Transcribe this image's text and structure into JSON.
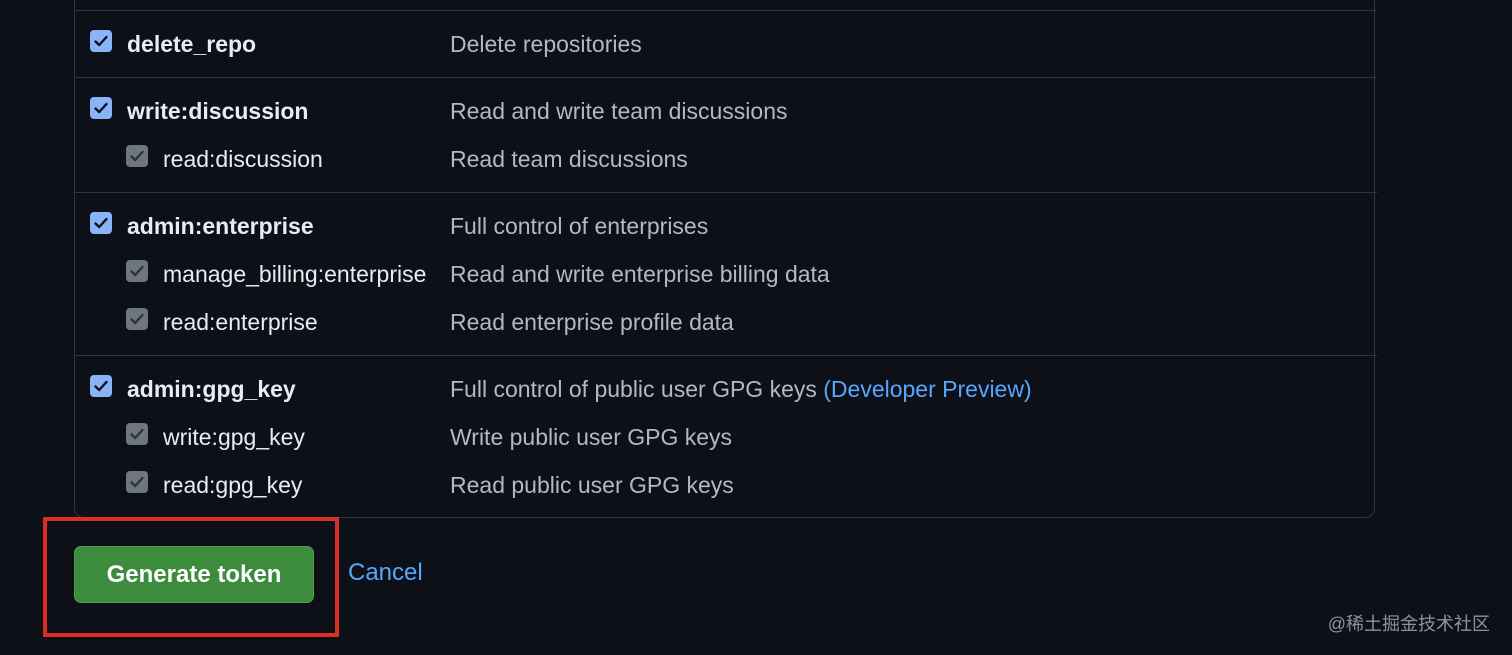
{
  "scope_groups": [
    {
      "scopes": [
        {
          "name": "delete_repo",
          "description": "Delete repositories",
          "checked": true,
          "primary": true
        }
      ]
    },
    {
      "scopes": [
        {
          "name": "write:discussion",
          "description": "Read and write team discussions",
          "checked": true,
          "primary": true
        },
        {
          "name": "read:discussion",
          "description": "Read team discussions",
          "checked": true,
          "primary": false
        }
      ]
    },
    {
      "scopes": [
        {
          "name": "admin:enterprise",
          "description": "Full control of enterprises",
          "checked": true,
          "primary": true
        },
        {
          "name": "manage_billing:enterprise",
          "description": "Read and write enterprise billing data",
          "checked": true,
          "primary": false
        },
        {
          "name": "read:enterprise",
          "description": "Read enterprise profile data",
          "checked": true,
          "primary": false
        }
      ]
    },
    {
      "scopes": [
        {
          "name": "admin:gpg_key",
          "description": "Full control of public user GPG keys",
          "link": "(Developer Preview)",
          "checked": true,
          "primary": true
        },
        {
          "name": "write:gpg_key",
          "description": "Write public user GPG keys",
          "checked": true,
          "primary": false
        },
        {
          "name": "read:gpg_key",
          "description": "Read public user GPG keys",
          "checked": true,
          "primary": false
        }
      ]
    }
  ],
  "actions": {
    "generate_label": "Generate token",
    "cancel_label": "Cancel"
  },
  "watermark": "@稀土掘金技术社区",
  "colors": {
    "background": "#0d1117",
    "primary_button": "#3d8b3d",
    "link": "#58a6ff",
    "highlight_border": "#d93025"
  }
}
